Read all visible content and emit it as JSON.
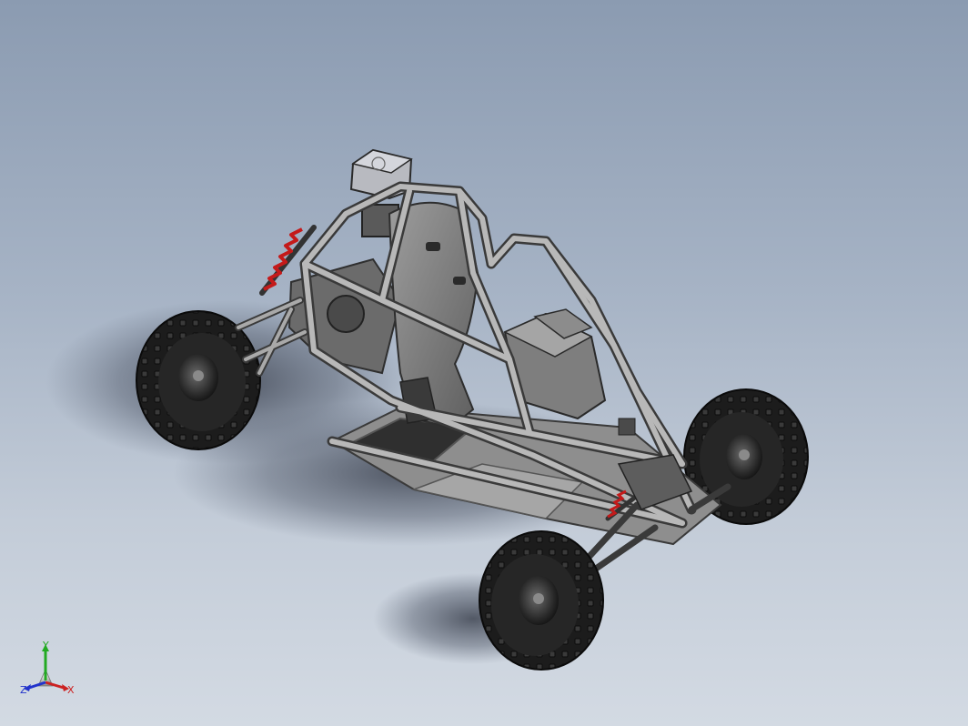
{
  "viewport": {
    "background_top": "#8b9bb1",
    "background_bottom": "#d3dae3"
  },
  "model": {
    "frame_color": "#9a9a9a",
    "tire_color": "#1e1e1e",
    "spring_color": "#c41a1a",
    "panel_color": "#8a8a8a"
  },
  "triad": {
    "x_label": "X",
    "y_label": "Y",
    "z_label": "Z",
    "x_color": "#cc2222",
    "y_color": "#22aa22",
    "z_color": "#2233cc"
  }
}
